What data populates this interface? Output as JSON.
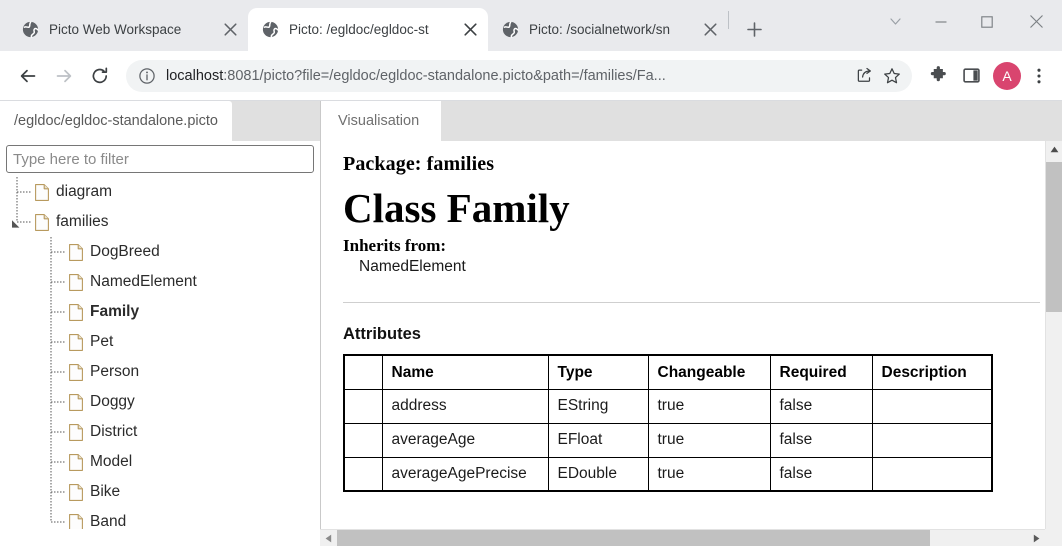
{
  "browser": {
    "tabs": [
      {
        "title": "Picto Web Workspace",
        "favicon": "globe-icon",
        "active": false,
        "close": "×"
      },
      {
        "title": "Picto: /egldoc/egldoc-st",
        "favicon": "globe-icon",
        "active": true,
        "close": "×"
      },
      {
        "title": "Picto: /socialnetwork/sn",
        "favicon": "globe-icon",
        "active": false,
        "close": "×"
      }
    ],
    "new_tab_label": "+",
    "window_controls": {
      "tab_search": "chevron-down-icon",
      "minimize": "minimize-icon",
      "maximize": "maximize-icon",
      "close": "close-icon"
    },
    "toolbar": {
      "back": "back-arrow-icon",
      "forward": "forward-arrow-icon",
      "reload": "reload-icon",
      "site_info": "info-circle-icon",
      "url_prefix": "localhost",
      "url_rest": ":8081/picto?file=/egldoc/egldoc-standalone.picto&path=/families/Fa...",
      "share": "share-icon",
      "bookmark": "star-icon",
      "extensions": "puzzle-icon",
      "side_panel": "side-panel-icon",
      "profile_initial": "A",
      "profile_color": "#d9456f",
      "menu": "three-dot-menu-icon"
    }
  },
  "left_panel": {
    "tab_label": "/egldoc/egldoc-standalone.picto",
    "filter": {
      "placeholder": "Type here to filter",
      "value": ""
    },
    "tree": [
      {
        "label": "diagram",
        "depth": 1,
        "bold": false,
        "expander": false,
        "last": false
      },
      {
        "label": "families",
        "depth": 1,
        "bold": false,
        "expander": true,
        "last": true
      },
      {
        "label": "DogBreed",
        "depth": 2,
        "bold": false,
        "expander": false,
        "last": false
      },
      {
        "label": "NamedElement",
        "depth": 2,
        "bold": false,
        "expander": false,
        "last": false
      },
      {
        "label": "Family",
        "depth": 2,
        "bold": true,
        "expander": false,
        "last": false
      },
      {
        "label": "Pet",
        "depth": 2,
        "bold": false,
        "expander": false,
        "last": false
      },
      {
        "label": "Person",
        "depth": 2,
        "bold": false,
        "expander": false,
        "last": false
      },
      {
        "label": "Doggy",
        "depth": 2,
        "bold": false,
        "expander": false,
        "last": false
      },
      {
        "label": "District",
        "depth": 2,
        "bold": false,
        "expander": false,
        "last": false
      },
      {
        "label": "Model",
        "depth": 2,
        "bold": false,
        "expander": false,
        "last": false
      },
      {
        "label": "Bike",
        "depth": 2,
        "bold": false,
        "expander": false,
        "last": false
      },
      {
        "label": "Band",
        "depth": 2,
        "bold": false,
        "expander": false,
        "last": true
      }
    ]
  },
  "right_panel": {
    "tab_label": "Visualisation",
    "package_heading": "Package: families",
    "class_heading": "Class Family",
    "inherits_label": "Inherits from:",
    "inherits_value": "NamedElement",
    "attributes_title": "Attributes",
    "table": {
      "headers": [
        "",
        "Name",
        "Type",
        "Changeable",
        "Required",
        "Description"
      ],
      "rows": [
        [
          "",
          "address",
          "EString",
          "true",
          "false",
          ""
        ],
        [
          "",
          "averageAge",
          "EFloat",
          "true",
          "false",
          ""
        ],
        [
          "",
          "averageAgePrecise",
          "EDouble",
          "true",
          "false",
          ""
        ]
      ]
    }
  },
  "scrollbars": {
    "vertical": {
      "up": "scroll-up-arrow",
      "down": "scroll-down-arrow"
    },
    "horizontal": {
      "left": "scroll-left-arrow",
      "right": "scroll-right-arrow"
    }
  }
}
